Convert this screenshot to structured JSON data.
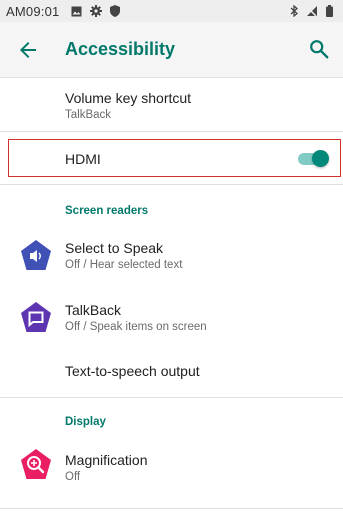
{
  "status_bar": {
    "time": "AM09:01"
  },
  "app_bar": {
    "title": "Accessibility"
  },
  "items": {
    "volume_key": {
      "title": "Volume key shortcut",
      "subtitle": "TalkBack"
    },
    "hdmi": {
      "title": "HDMI",
      "toggle_on": true
    },
    "select_to_speak": {
      "title": "Select to Speak",
      "subtitle": "Off / Hear selected text"
    },
    "talkback": {
      "title": "TalkBack",
      "subtitle": "Off / Speak items on screen"
    },
    "tts": {
      "title": "Text-to-speech output"
    },
    "magnification": {
      "title": "Magnification",
      "subtitle": "Off"
    }
  },
  "sections": {
    "screen_readers": "Screen readers",
    "display": "Display"
  },
  "colors": {
    "accent": "#00796b",
    "select_to_speak_icon": "#3f51b5",
    "talkback_icon": "#5e35b1",
    "magnification_icon": "#e91e63",
    "highlight": "#d32f2f"
  },
  "icons": {
    "status_left": [
      "image-icon",
      "gear-icon",
      "shield-icon"
    ],
    "status_right": [
      "bluetooth-icon",
      "no-signal-icon",
      "battery-icon"
    ],
    "back": "back-arrow-icon",
    "search": "search-icon"
  }
}
